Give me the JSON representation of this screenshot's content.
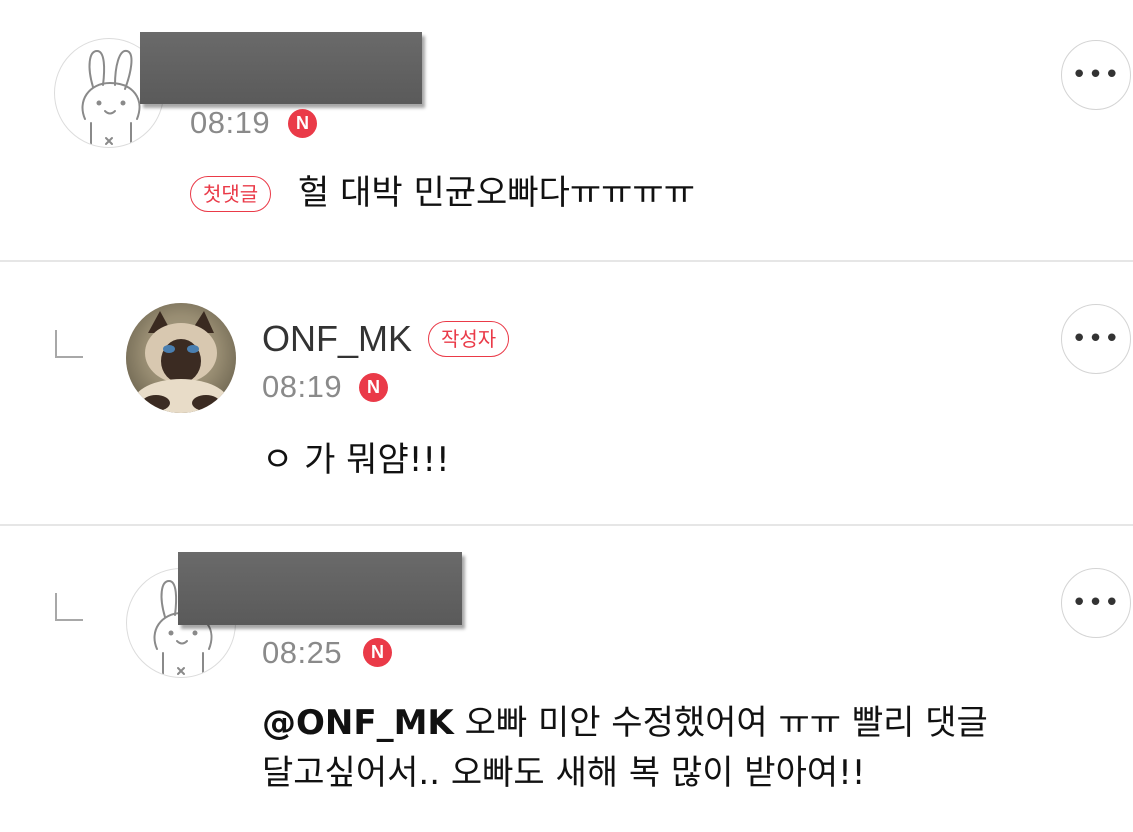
{
  "comments": [
    {
      "time": "08:19",
      "new_badge": "N",
      "tag": "첫댓글",
      "text": "헐 대박 민균오빠다ㅠㅠㅠㅠ",
      "more_label": "•••",
      "avatar_icon": "rabbit-avatar-icon",
      "author_redacted": true
    },
    {
      "author": "ONF_MK",
      "author_tag": "작성자",
      "time": "08:19",
      "new_badge": "N",
      "text": "ㅇ 가 뭐얌!!!",
      "more_label": "•••",
      "avatar_icon": "cat-photo-avatar",
      "is_reply": true
    },
    {
      "time": "08:25",
      "new_badge": "N",
      "mention": "@ONF_MK",
      "text_line1": " 오빠 미안 수정했어여 ㅠㅠ 빨리 댓글",
      "text_line2": "달고싶어서.. 오빠도 새해 복 많이 받아여!!",
      "more_label": "•••",
      "avatar_icon": "rabbit-avatar-icon",
      "author_redacted": true,
      "is_reply": true
    }
  ],
  "colors": {
    "accent_red": "#ea3a48",
    "time_gray": "#8a8a8a",
    "redaction": "#5f5f5f"
  }
}
